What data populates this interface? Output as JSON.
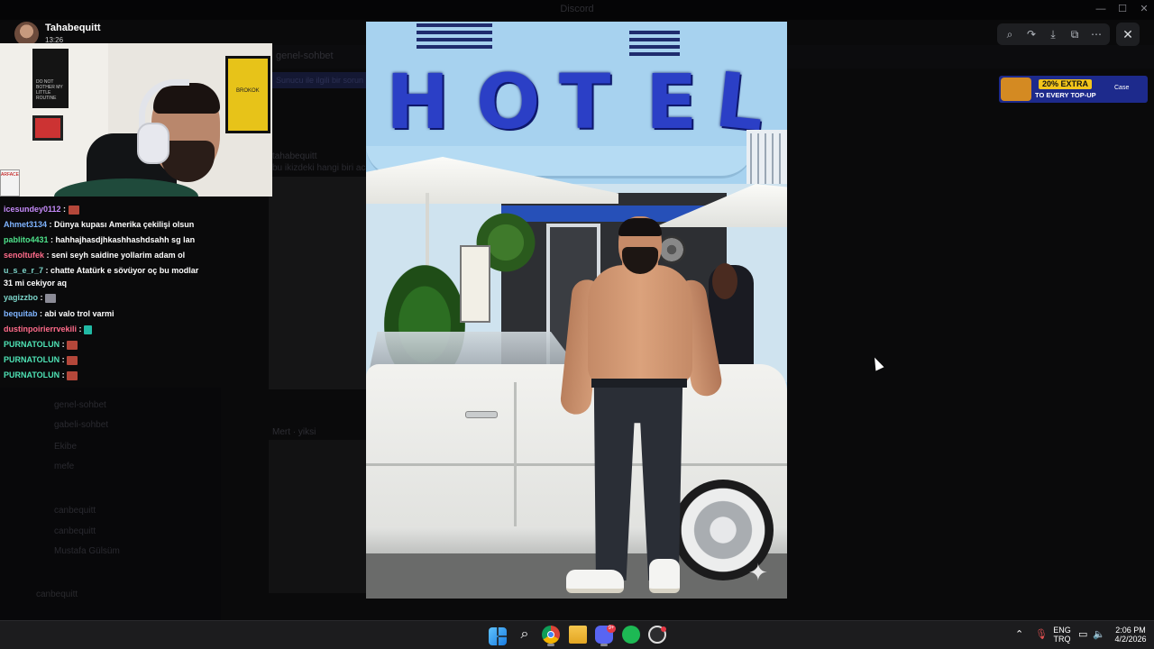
{
  "background_app": {
    "window_title": "Discord",
    "channel_header": "genel-sohbet",
    "banner_text": "Sunucu ile ilgili bir sorun",
    "message_user": "tahabequitt",
    "message_text": "bu ikizdeki hangi biri acaba",
    "sidebar_channels": [
      "genel-sohbet",
      "gabeli-sohbet",
      "Ekibe",
      "mefe",
      "canbequitt",
      "canbequitt",
      "Mustafa Gülsüm"
    ],
    "sidebar_user": "canbequitt",
    "second_message_user": "Mert · yiksi"
  },
  "viewer_toolbar": {
    "zoom": "zoom-icon",
    "forward": "forward-icon",
    "download": "download-icon",
    "open_external": "open-external-icon",
    "more": "more-icon",
    "close": "close-icon"
  },
  "ad": {
    "headline": "20% EXTRA",
    "subline": "TO EVERY TOP-UP",
    "brand": "Case"
  },
  "stream": {
    "streamer_name": "Tahabequitt",
    "time": "13:26",
    "webcam_poster_text": "DO NOT BOTHER MY LITTLE ROUTINE",
    "webcam_frame_text": "BROKOK",
    "webcam_sign_text": "ARFACE"
  },
  "chat": [
    {
      "user": "icesundey0112",
      "user_color": "#c58af9",
      "text": " : ",
      "emote": "red"
    },
    {
      "user": "Ahmet3134",
      "user_color": "#7fb4ff",
      "text": " : Dünya kupası Amerika çekilişi olsun",
      "emote": ""
    },
    {
      "user": "pablito4431",
      "user_color": "#4ee38b",
      "text": " : hahhajhasdjhkashhashdsahh sg lan",
      "emote": ""
    },
    {
      "user": "senoltufek",
      "user_color": "#ff6b8a",
      "text": " : seni seyh saidine yollarim adam ol",
      "emote": ""
    },
    {
      "user": "u_s_e_r_7",
      "user_color": "#7cd4c9",
      "text": " : chatte Atatürk e sövüyor oç bu modlar",
      "emote": ""
    },
    {
      "user": "",
      "user_color": "#ffffff",
      "text": "31 mi cekiyor aq",
      "emote": ""
    },
    {
      "user": "yagizzbo",
      "user_color": "#7cd4c9",
      "text": " : ",
      "emote": "gray"
    },
    {
      "user": "bequitab",
      "user_color": "#7fb4ff",
      "text": " : abi valo trol varmi",
      "emote": ""
    },
    {
      "user": "dustinpoirierrvekili",
      "user_color": "#ff6b8a",
      "text": " : ",
      "emote": "teal"
    },
    {
      "user": "PURNATOLUN",
      "user_color": "#4ee3b5",
      "text": " : ",
      "emote": "red"
    },
    {
      "user": "PURNATOLUN",
      "user_color": "#4ee3b5",
      "text": " : ",
      "emote": "red"
    },
    {
      "user": "PURNATOLUN",
      "user_color": "#4ee3b5",
      "text": " : ",
      "emote": "red"
    }
  ],
  "viewer_image": {
    "sign_letters": [
      "H",
      "O",
      "T",
      "E",
      "L"
    ]
  },
  "taskbar": {
    "apps": [
      "windows-start-icon",
      "search-icon",
      "chrome-icon",
      "file-explorer-icon",
      "discord-icon",
      "spotify-icon",
      "steam-icon"
    ],
    "discord_badge": "9+",
    "language_line1": "ENG",
    "language_line2": "TRQ",
    "time": "2:06 PM",
    "date": "4/2/2026"
  },
  "colors": {
    "ad_background": "#1d2a8c",
    "ad_highlight": "#f3c51b",
    "hotel_letters": "#2b3fc6",
    "taskbar": "#1c1c1e"
  }
}
